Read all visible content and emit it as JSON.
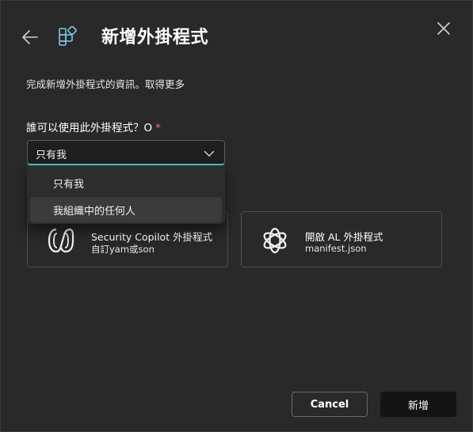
{
  "header": {
    "title": "新增外掛程式",
    "back_icon": "arrow-left-icon",
    "close_icon": "close-icon",
    "app_icon": "apps-add-icon"
  },
  "description": {
    "text": "完成新增外掛程式的資訊。",
    "learn_more": "取得更多"
  },
  "visibility": {
    "label": "誰可以使用此外掛程式？O",
    "required_mark": "*",
    "selected": "只有我",
    "options": [
      "只有我",
      "我組織中的任何人"
    ]
  },
  "plugin_types": [
    {
      "title": "Security Copilot 外掛程式",
      "subtitle": "自訂yam或son",
      "icon": "copilot-logo-icon"
    },
    {
      "title": "開啟 AL 外掛程式",
      "subtitle": "manifest.json",
      "icon": "openai-logo-icon"
    }
  ],
  "footer": {
    "cancel_label": "Cancel",
    "add_label": "新增"
  },
  "colors": {
    "accent": "#57c3c8",
    "required": "#e37373",
    "background": "#292929"
  }
}
